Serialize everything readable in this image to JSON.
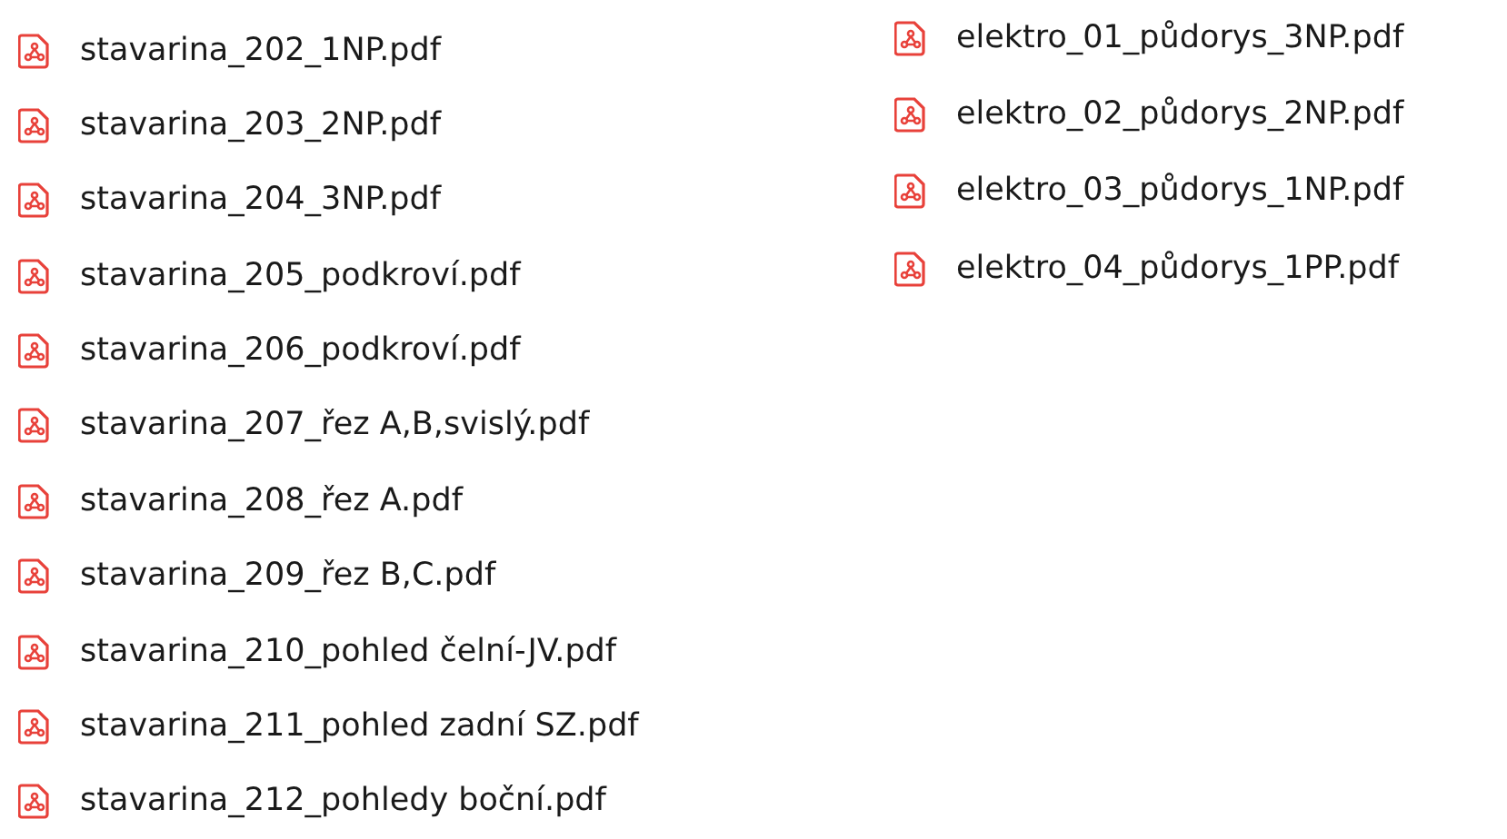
{
  "columns": [
    {
      "files": [
        {
          "name": "stavarina_202_1NP.pdf"
        },
        {
          "name": "stavarina_203_2NP.pdf"
        },
        {
          "name": "stavarina_204_3NP.pdf"
        },
        {
          "name": "stavarina_205_podkroví.pdf"
        },
        {
          "name": "stavarina_206_podkroví.pdf"
        },
        {
          "name": "stavarina_207_řez A,B,svislý.pdf"
        },
        {
          "name": "stavarina_208_řez A.pdf"
        },
        {
          "name": "stavarina_209_řez B,C.pdf"
        },
        {
          "name": "stavarina_210_pohled čelní-JV.pdf"
        },
        {
          "name": "stavarina_211_pohled zadní SZ.pdf"
        },
        {
          "name": "stavarina_212_pohledy boční.pdf"
        }
      ]
    },
    {
      "files": [
        {
          "name": "elektro_01_půdorys_3NP.pdf"
        },
        {
          "name": "elektro_02_půdorys_2NP.pdf"
        },
        {
          "name": "elektro_03_půdorys_1NP.pdf"
        },
        {
          "name": "elektro_04_půdorys_1PP.pdf"
        }
      ]
    }
  ]
}
